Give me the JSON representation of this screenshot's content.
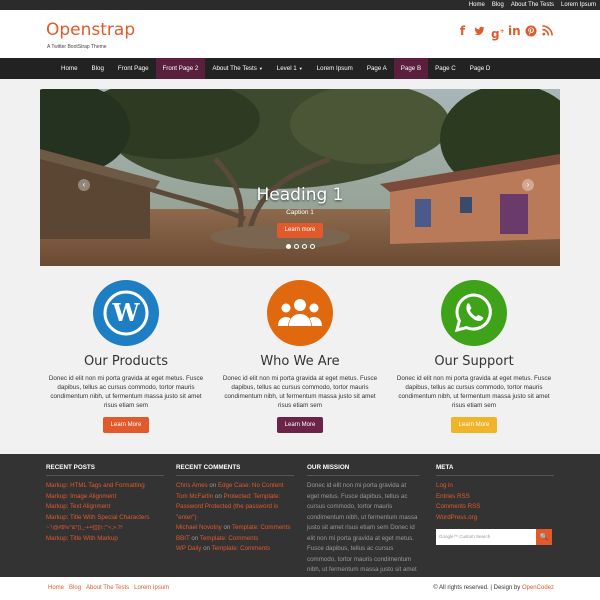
{
  "top_links": [
    "Home",
    "Blog",
    "About The Tests",
    "Lorem Ipsum"
  ],
  "header": {
    "brand": "Openstrap",
    "tagline": "A Twitter BootStrap Theme",
    "social_icons": [
      "facebook-icon",
      "twitter-icon",
      "google-plus-icon",
      "linkedin-icon",
      "pinterest-icon",
      "rss-icon"
    ]
  },
  "nav": {
    "items": [
      {
        "label": "Home"
      },
      {
        "label": "Blog"
      },
      {
        "label": "Front Page"
      },
      {
        "label": "Front Page 2",
        "active": true
      },
      {
        "label": "About The Tests",
        "caret": true
      },
      {
        "label": "Level 1",
        "caret": true
      },
      {
        "label": "Lorem Ipsum"
      },
      {
        "label": "Page A"
      },
      {
        "label": "Page B",
        "active": true
      },
      {
        "label": "Page C"
      },
      {
        "label": "Page D"
      }
    ]
  },
  "carousel": {
    "heading": "Heading 1",
    "caption": "Caption 1",
    "button": "Learn more",
    "slides": 4,
    "active_slide": 1,
    "prev_symbol": "‹",
    "next_symbol": "›"
  },
  "features": [
    {
      "title": "Our Products",
      "text": "Donec id elit non mi porta gravida at eget metus. Fusce dapibus, tellus ac cursus commodo, tortor mauris condimentum nibh, ut fermentum massa justo sit amet risus etiam sem",
      "button": "Learn More",
      "icon": "wordpress-icon",
      "circle_color": "#1e7ec3",
      "button_color": "#e05a2b"
    },
    {
      "title": "Who We Are",
      "text": "Donec id elit non mi porta gravida at eget metus. Fusce dapibus, tellus ac cursus commodo, tortor mauris condimentum nibh, ut fermentum massa justo sit amet risus etiam sem",
      "button": "Learn More",
      "icon": "people-icon",
      "circle_color": "#e0680f",
      "button_color": "#6b2447"
    },
    {
      "title": "Our Support",
      "text": "Donec id elit non mi porta gravida at eget metus. Fusce dapibus, tellus ac cursus commodo, tortor mauris condimentum nibh, ut fermentum massa justo sit amet risus etiam sem",
      "button": "Learn More",
      "icon": "whatsapp-icon",
      "circle_color": "#3fa31a",
      "button_color": "#f0b429"
    }
  ],
  "footer": {
    "recent_posts": {
      "title": "RECENT POSTS",
      "items": [
        "Markup: HTML Tags and Formatting",
        "Markup: Image Alignment",
        "Markup: Text Alignment",
        "Markup: Title With Special Characters",
        "~`!@#$%^&*()_-+={[}]|\\:;\"'<,>.?/",
        "Markup: Title With Markup"
      ]
    },
    "recent_comments": {
      "title": "RECENT COMMENTS",
      "items": [
        {
          "author": "Chris Ames",
          "on": "on",
          "post": "Edge Case: No Content"
        },
        {
          "author": "Tom McFarlin",
          "on": "on",
          "post": "Protected: Template: Password Protected (the password is \"enter\")"
        },
        {
          "author": "Michael Novotny",
          "on": "on",
          "post": "Template: Comments"
        },
        {
          "author": "BBIT",
          "on": "on",
          "post": "Template: Comments"
        },
        {
          "author": "WP Daily",
          "on": "on",
          "post": "Template: Comments"
        }
      ]
    },
    "mission": {
      "title": "OUR MISSION",
      "text": "Donec id elit non mi porta gravida at eget metus. Fusce dapibus, tellus ac cursus commodo, tortor mauris condimentum nibh, ut fermentum massa justo sit amet risus etiam sem Donec id elit non mi porta gravida at eget metus. Fusce dapibus, tellus ac cursus commodo, tortor mauris condimentum nibh, ut fermentum massa justo sit amet risus etiam sem"
    },
    "meta": {
      "title": "META",
      "items": [
        "Log in",
        "Entries RSS",
        "Comments RSS",
        "WordPress.org"
      ],
      "search_placeholder": "Google™ Custom Search",
      "search_button": "🔍"
    }
  },
  "bottom": {
    "links": [
      "Home",
      "Blog",
      "About The Tests",
      "Lorem Ipsum"
    ],
    "copyright": "© All rights reserved. | Design by",
    "designer": "OpenCodez"
  }
}
